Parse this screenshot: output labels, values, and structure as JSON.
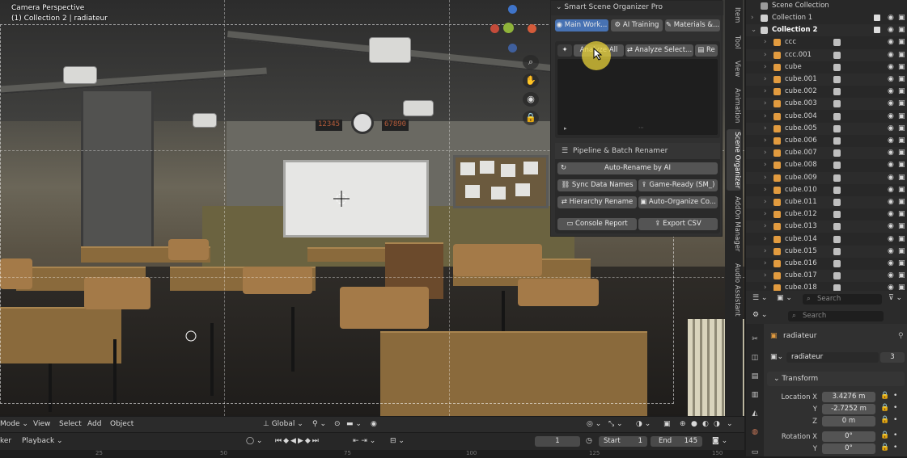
{
  "viewport": {
    "overlay_title": "Camera Perspective",
    "overlay_subtitle": "(1) Collection 2 | radiateur",
    "digital_left": "12345",
    "digital_right": "67890"
  },
  "addon_panel": {
    "title": "Smart Scene Organizer Pro",
    "tabs": [
      "Main Work...",
      "AI Training",
      "Materials &..."
    ],
    "analyze_all": "Analyze All",
    "analyze_selected": "Analyze Select...",
    "re": "Re",
    "section_title": "Pipeline & Batch Renamer",
    "auto_rename": "Auto-Rename by AI",
    "sync_names": "Sync Data Names",
    "game_ready": "Game-Ready (SM_)",
    "hierarchy_rename": "Hierarchy Rename",
    "auto_organize": "Auto-Organize Co...",
    "console_report": "Console Report",
    "export_csv": "Export CSV"
  },
  "side_tabs": [
    "Item",
    "Tool",
    "View",
    "Animation",
    "Scene Organizer",
    "AddOn Manager",
    "Audio Assistant"
  ],
  "viewport_header": {
    "mode": "Mode",
    "menus": [
      "View",
      "Select",
      "Add",
      "Object"
    ],
    "orientation": "Global"
  },
  "timeline": {
    "left_label": "ker",
    "playback": "Playback",
    "current_frame": "1",
    "start_label": "Start",
    "start": "1",
    "end_label": "End",
    "end": "145",
    "ruler_ticks": [
      "25",
      "50",
      "75",
      "100",
      "125",
      "150"
    ]
  },
  "outliner": {
    "root": "Scene Collection",
    "items": [
      {
        "name": "Collection 1",
        "level": 1
      },
      {
        "name": "Collection 2",
        "level": 1
      },
      {
        "name": "ccc",
        "level": 2
      },
      {
        "name": "ccc.001",
        "level": 2
      },
      {
        "name": "cube",
        "level": 2
      },
      {
        "name": "cube.001",
        "level": 2
      },
      {
        "name": "cube.002",
        "level": 2
      },
      {
        "name": "cube.003",
        "level": 2
      },
      {
        "name": "cube.004",
        "level": 2
      },
      {
        "name": "cube.005",
        "level": 2
      },
      {
        "name": "cube.006",
        "level": 2
      },
      {
        "name": "cube.007",
        "level": 2
      },
      {
        "name": "cube.008",
        "level": 2
      },
      {
        "name": "cube.009",
        "level": 2
      },
      {
        "name": "cube.010",
        "level": 2
      },
      {
        "name": "cube.011",
        "level": 2
      },
      {
        "name": "cube.012",
        "level": 2
      },
      {
        "name": "cube.013",
        "level": 2
      },
      {
        "name": "cube.014",
        "level": 2
      },
      {
        "name": "cube.015",
        "level": 2
      },
      {
        "name": "cube.016",
        "level": 2
      },
      {
        "name": "cube.017",
        "level": 2
      },
      {
        "name": "cube.018",
        "level": 2
      }
    ],
    "search_placeholder": "Search"
  },
  "properties": {
    "search_placeholder": "Search",
    "object_name": "radiateur",
    "data_name": "radiateur",
    "users": "3",
    "transform_title": "Transform",
    "location_x_label": "Location X",
    "location_x": "3.4276 m",
    "y_label": "Y",
    "location_y": "-2.7252 m",
    "z_label": "Z",
    "location_z": "0 m",
    "rotation_x_label": "Rotation X",
    "rotation_x": "0°",
    "rotation_y_label": "Y",
    "rotation_y": "0°"
  },
  "colors": {
    "accent": "#4772b3",
    "cursor_highlight": "#e8d23a",
    "object_icon": "#e29b3f"
  }
}
